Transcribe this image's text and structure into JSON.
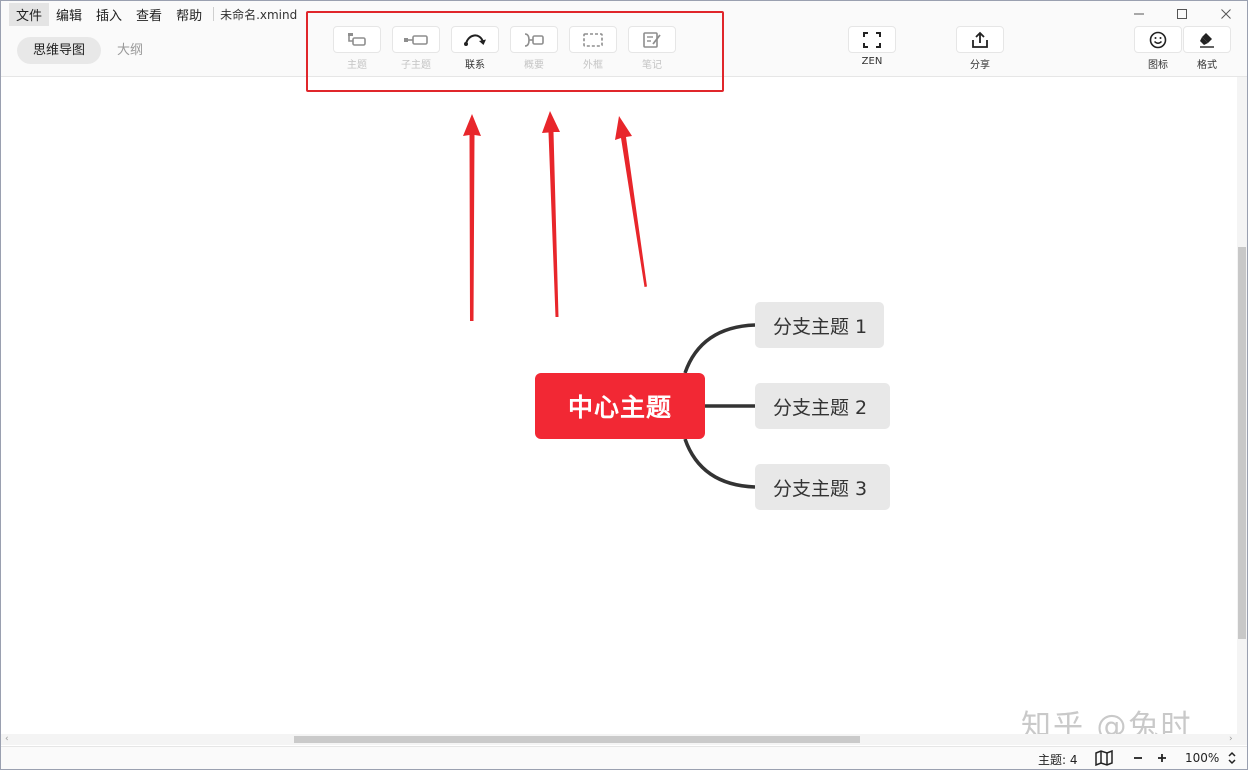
{
  "menu": {
    "items": [
      "文件",
      "编辑",
      "插入",
      "查看",
      "帮助"
    ],
    "active_index": 0,
    "doc_title": "未命名.xmind"
  },
  "view_tabs": [
    {
      "label": "思维导图",
      "active": true
    },
    {
      "label": "大纲",
      "active": false
    }
  ],
  "toolbar": {
    "topic": {
      "label": "主题",
      "icon": "topic-icon",
      "enabled": false
    },
    "subtopic": {
      "label": "子主题",
      "icon": "subtopic-icon",
      "enabled": false
    },
    "relationship": {
      "label": "联系",
      "icon": "relationship-arrow-icon",
      "enabled": true
    },
    "summary": {
      "label": "概要",
      "icon": "summary-icon",
      "enabled": false
    },
    "boundary": {
      "label": "外框",
      "icon": "boundary-icon",
      "enabled": false
    },
    "note": {
      "label": "笔记",
      "icon": "note-icon",
      "enabled": false
    },
    "zen": {
      "label": "ZEN",
      "icon": "fullscreen-icon"
    },
    "share": {
      "label": "分享",
      "icon": "share-icon"
    },
    "icons": {
      "label": "图标",
      "icon": "smiley-icon"
    },
    "format": {
      "label": "格式",
      "icon": "brush-icon"
    }
  },
  "mindmap": {
    "central": "中心主题",
    "branches": [
      "分支主题 1",
      "分支主题 2",
      "分支主题 3"
    ]
  },
  "watermark": "知乎 @兔时",
  "statusbar": {
    "topic_count": "主题: 4",
    "zoom": "100%"
  },
  "colors": {
    "central_topic": "#f22834",
    "annotation_red": "#e0262b",
    "branch_bg": "#e8e8e8"
  }
}
